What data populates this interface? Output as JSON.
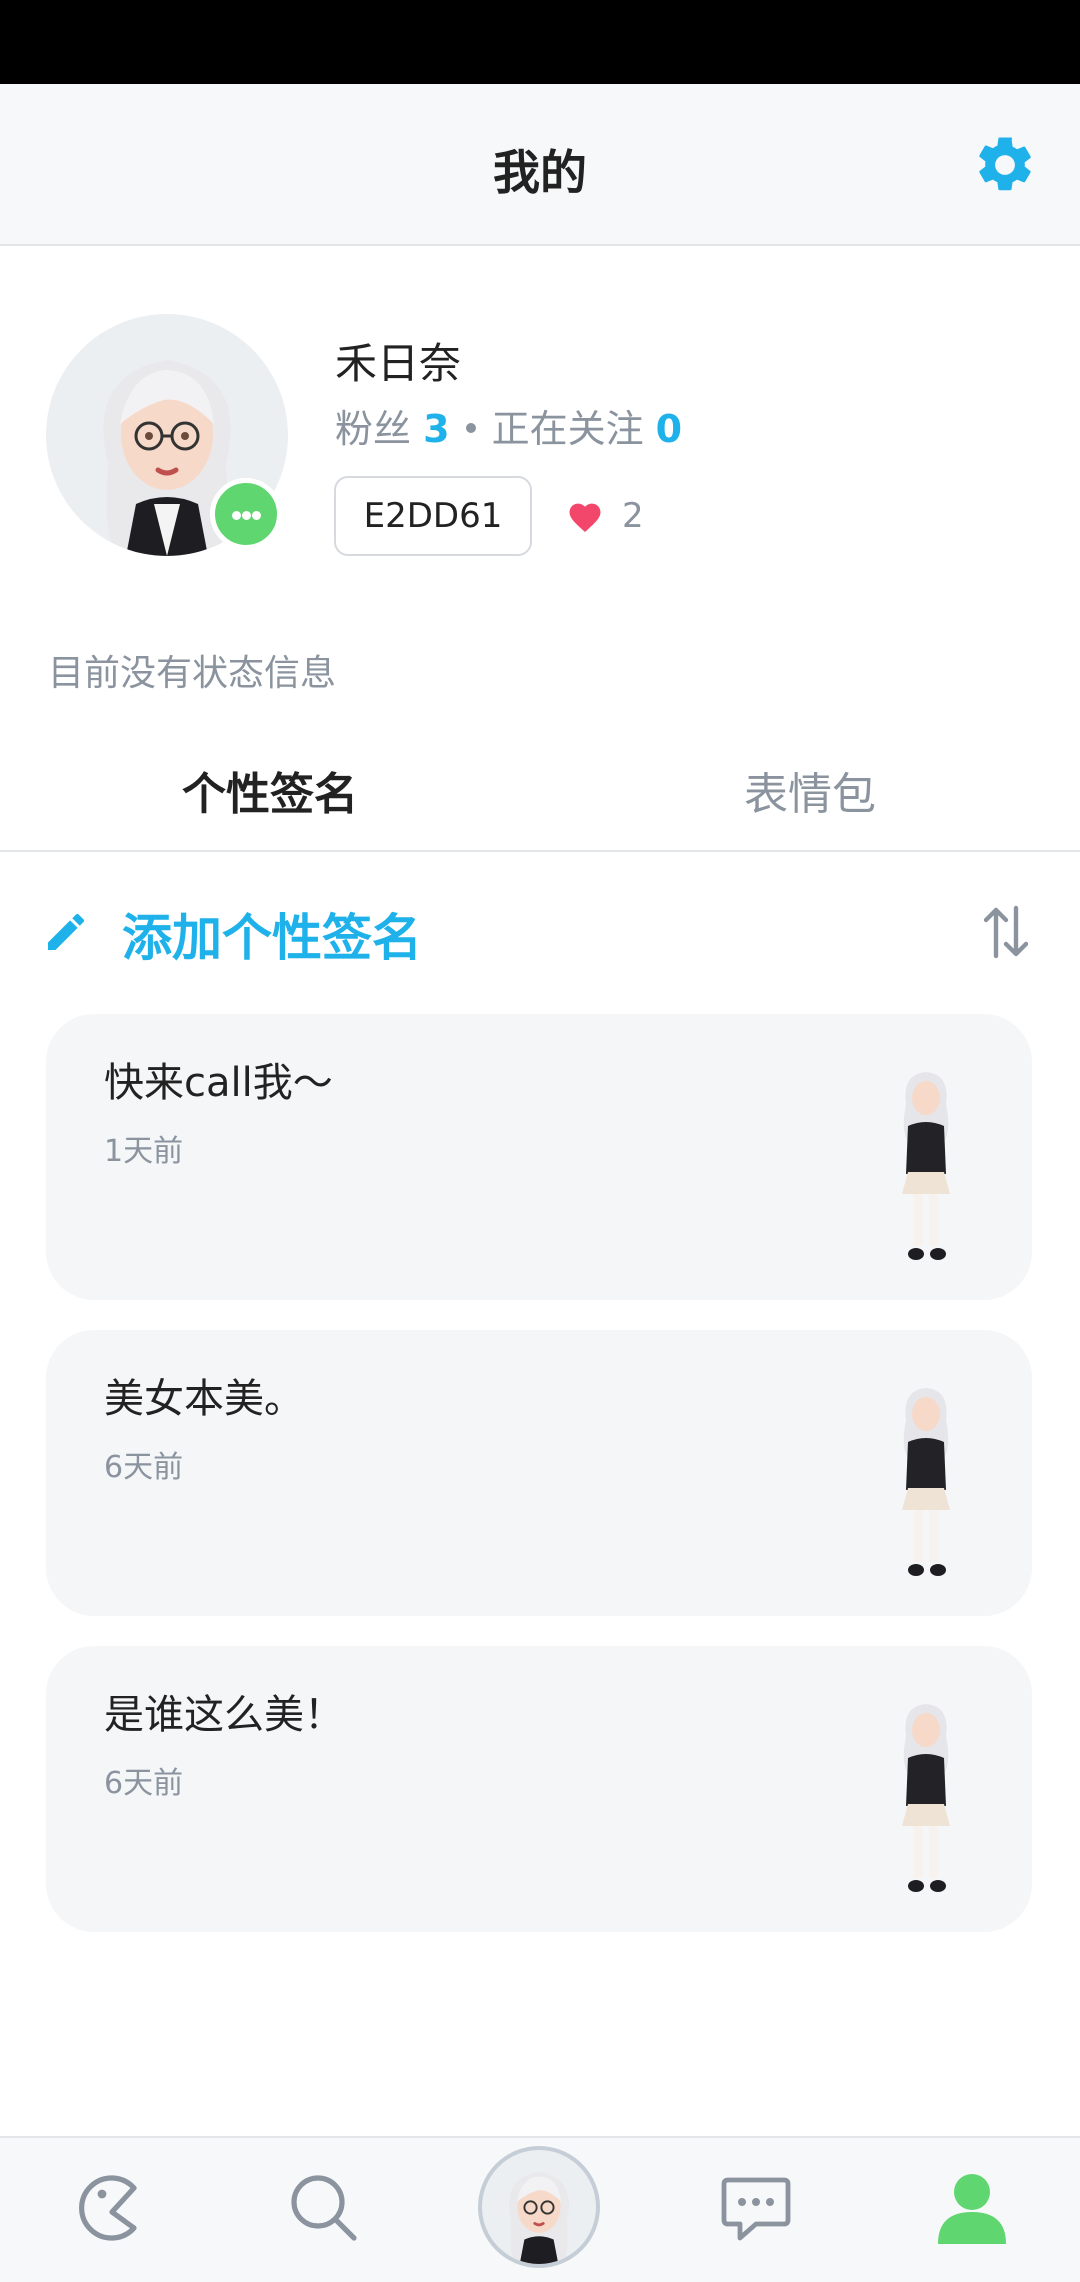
{
  "header": {
    "title": "我的",
    "settings_icon": "gear-icon"
  },
  "profile": {
    "name": "禾日奈",
    "followers_label": "粉丝",
    "followers_count": "3",
    "following_label": "正在关注",
    "following_count": "0",
    "code": "E2DD61",
    "likes": "2",
    "status_text": "目前没有状态信息"
  },
  "tabs": [
    {
      "label": "个性签名",
      "active": true
    },
    {
      "label": "表情包",
      "active": false
    }
  ],
  "add_signature": {
    "label": "添加个性签名"
  },
  "signatures": [
    {
      "text": "快来call我～",
      "time": "1天前"
    },
    {
      "text": "美女本美。",
      "time": "6天前"
    },
    {
      "text": "是谁这么美！",
      "time": "6天前"
    }
  ],
  "colors": {
    "accent": "#1fb1ea",
    "green": "#5fd66f",
    "heart": "#f2466b",
    "muted": "#8a939e"
  },
  "bottom_nav": [
    {
      "name": "pacman",
      "icon": "pacman-icon"
    },
    {
      "name": "search",
      "icon": "search-icon"
    },
    {
      "name": "avatar",
      "icon": "avatar"
    },
    {
      "name": "messages",
      "icon": "chat-icon"
    },
    {
      "name": "profile",
      "icon": "person-icon",
      "active": true
    }
  ]
}
